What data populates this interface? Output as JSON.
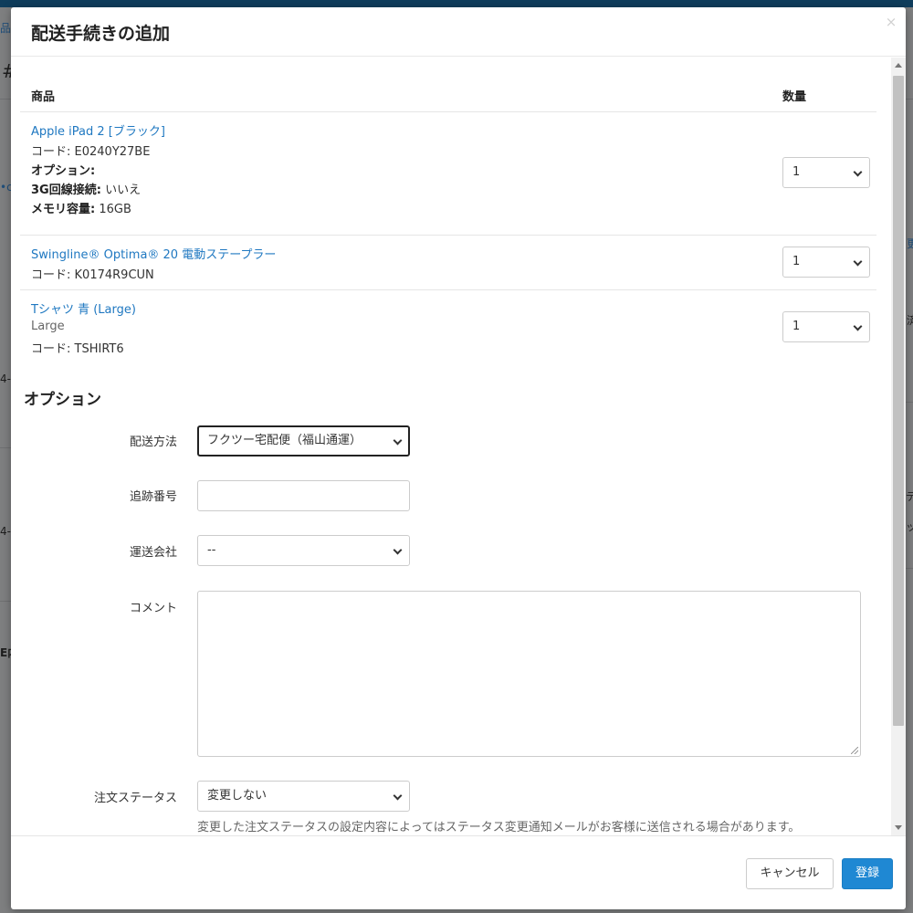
{
  "background": {
    "fragments": [
      "品",
      "#",
      "•c",
      "4-",
      "4-",
      "E内",
      "更",
      "済",
      "テ",
      "ッ"
    ]
  },
  "modal": {
    "title": "配送手続きの追加",
    "close_icon": "×"
  },
  "items_table": {
    "headers": {
      "product": "商品",
      "quantity": "数量"
    },
    "items": [
      {
        "name": "Apple iPad 2 [ブラック]",
        "code_label": "コード:",
        "code": "E0240Y27BE",
        "options_label": "オプション:",
        "option_1_label": "3G回線接続:",
        "option_1_value": "いいえ",
        "option_2_label": "メモリ容量:",
        "option_2_value": "16GB",
        "quantity": "1"
      },
      {
        "name": "Swingline® Optima® 20 電動ステープラー",
        "code_label": "コード:",
        "code": "K0174R9CUN",
        "quantity": "1"
      },
      {
        "name": "Tシャツ 青 (Large)",
        "variant": "Large",
        "code_label": "コード:",
        "code": "TSHIRT6",
        "quantity": "1"
      }
    ]
  },
  "options": {
    "title": "オプション",
    "shipping_method_label": "配送方法",
    "shipping_method_value": "フクツー宅配便（福山通運）",
    "tracking_label": "追跡番号",
    "tracking_value": "",
    "carrier_label": "運送会社",
    "carrier_value": "--",
    "comment_label": "コメント",
    "comment_value": "",
    "order_status_label": "注文ステータス",
    "order_status_value": "変更しない",
    "order_status_help": "変更した注文ステータスの設定内容によってはステータス変更通知メールがお客様に送信される場合があります。"
  },
  "footer": {
    "cancel_label": "キャンセル",
    "submit_label": "登録"
  },
  "colors": {
    "link": "#1f78c1",
    "primary": "#1f88d3",
    "overlay": "#7e7f80"
  }
}
